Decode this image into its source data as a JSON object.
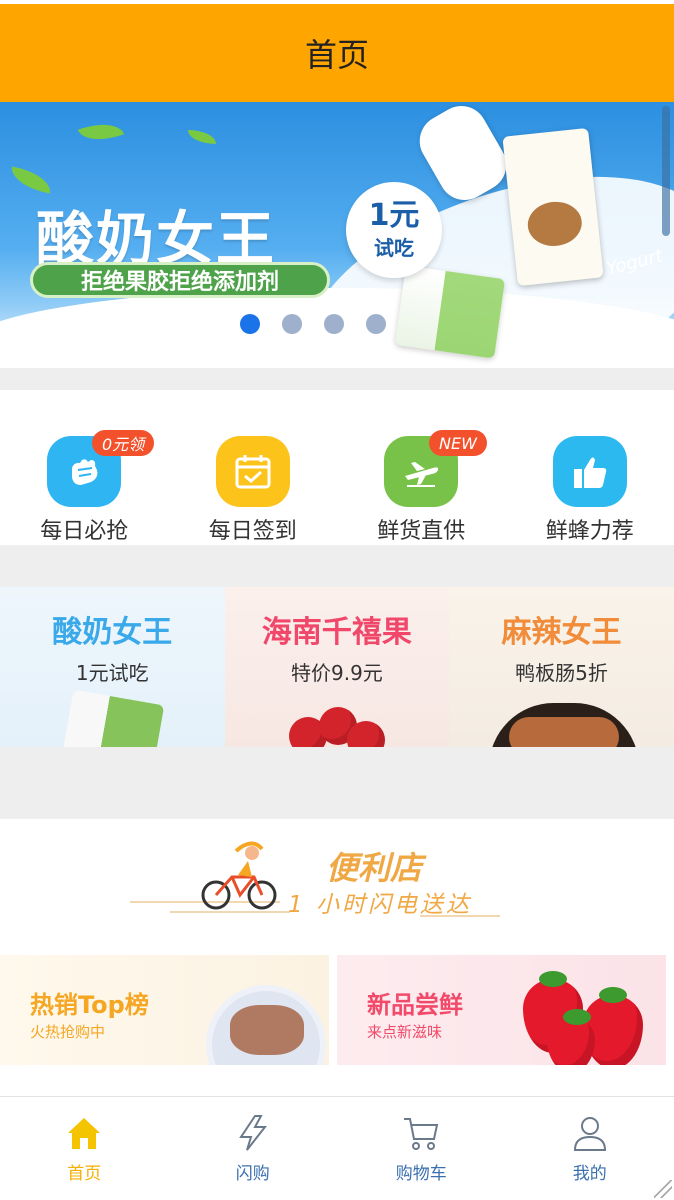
{
  "header": {
    "title": "首页"
  },
  "banner": {
    "title": "酸奶女王",
    "subtitle": "拒绝果胶拒绝添加剂",
    "badge_line1": "1元",
    "badge_line2": "试吃",
    "script_word": "Yogurt",
    "slides_count": 4,
    "active_slide": 1
  },
  "quick": {
    "items": [
      {
        "label": "每日必抢",
        "icon": "fist-icon",
        "tag": "0元领",
        "color": "#2fb6f2"
      },
      {
        "label": "每日签到",
        "icon": "calendar-check-icon",
        "tag": "",
        "color": "#fcc41b"
      },
      {
        "label": "鲜货直供",
        "icon": "airplane-icon",
        "tag": "NEW",
        "color": "#79c24a"
      },
      {
        "label": "鲜蜂力荐",
        "icon": "thumbs-up-icon",
        "tag": "",
        "color": "#2cb9ef"
      }
    ]
  },
  "promos": [
    {
      "title": "酸奶女王",
      "subtitle": "1元试吃",
      "title_color": "#3aa9ea"
    },
    {
      "title": "海南千禧果",
      "subtitle": "特价9.9元",
      "title_color": "#f0476a"
    },
    {
      "title": "麻辣女王",
      "subtitle": "鸭板肠5折",
      "title_color": "#f08c3a"
    }
  ],
  "store": {
    "title": "便利店",
    "subtitle": "1 小时闪电送达"
  },
  "categories": [
    {
      "title": "热销Top榜",
      "subtitle": "火热抢购中"
    },
    {
      "title": "新品尝鲜",
      "subtitle": "来点新滋味"
    }
  ],
  "tabbar": {
    "active": "首页",
    "items": [
      {
        "label": "首页",
        "icon": "home-icon"
      },
      {
        "label": "闪购",
        "icon": "lightning-icon"
      },
      {
        "label": "购物车",
        "icon": "cart-icon"
      },
      {
        "label": "我的",
        "icon": "user-icon"
      }
    ]
  },
  "colors": {
    "header": "#ffa500",
    "tab_active": "#f5b000",
    "tab_inactive": "#3a6fb0"
  }
}
